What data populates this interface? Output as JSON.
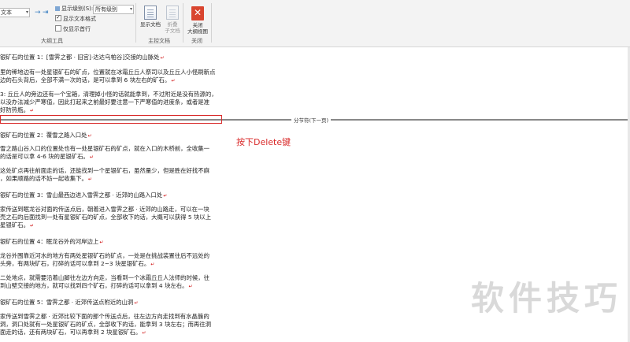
{
  "ribbon": {
    "outline_tools": {
      "text_combo": "文本",
      "show_level_label": "显示级别(S):",
      "show_level_value": "所有级别",
      "show_text_format": "显示文本格式",
      "show_first_line": "仅显示首行",
      "group_label": "大纲工具"
    },
    "master_doc": {
      "show_doc": "显示文档",
      "collapse_sub_l1": "折叠",
      "collapse_sub_l2": "子文档",
      "group_label": "主控文档"
    },
    "close": {
      "btn_l1": "关闭",
      "btn_l2": "大纲视图",
      "group_label": "关闭"
    }
  },
  "doc": {
    "lines": [
      "银矿石的位置 1：[雪霁之都 · 旧宫]·达达乌帕谷]交接的山脉处",
      "里的稀地边有一处星银矿石的矿点，位置就在冰霜丘丘人祭司以及丘丘人小怪刷新点",
      "边的石头背后，全部不满一次的话，是可以拿到 6 块左右的矿石。",
      "3: 丘丘人的旁边还有一个宝箱，清理掉小怪的话就能拿到，不过附近是没有热源的，",
      "以没办法减少严寒值，因此打起来之前最好要注意一下严寒值的进度条，或者是准",
      "好防热瓶。",
      "银矿石的位置 2：覆雪之路入口处",
      "雪之路山谷入口的位置处也有一处星银矿石的矿点，就在入口的木桥前，全收集一",
      "的话是可以拿 4-6 块的星银矿石。",
      "这处矿点再往前面走的话，还能找到一个星银矿石，虽然量少，但是胜在好找不麻",
      "，如果顺路的话不妨一起收集下。",
      "银矿石的位置 3：雪山最西边进入雪霁之都 · 近郊的山路入口处",
      "家传送到眠龙谷对面的传送点后，朝着进入雪霁之都 · 近郊的山路走，可以在一块",
      "壳之石的后面找到一处有星银矿石的矿点，全部收下的话，大概可以获得 5 块以上",
      "星银矿石。",
      "银矿石的位置 4：眠龙谷外的河岸边上",
      "龙谷外围靠近河水的地方有两处星银矿石的矿点，一处是在挑战装置往后不远处的",
      "头旁，有两块矿石，打碎的话可以拿到 2~3 块星银矿石。",
      "二处地点，就需要沿着山脚往左边方向走，当看到一个冰霜丘丘人法师的时候，往",
      "到山壁交接的地方，就可以找到四个矿石，打碎的话可以拿到 4 块左右。",
      "银矿石的位置 5：雪霁之都 · 近郊传送点附近的山洞",
      "家传送到雪霁之都 · 近郊比较下面的那个传送点后，往左边方向走找到有水晶簇的",
      "洞，洞口处就有一处星银矿石的矿点，全部收下的话，能拿到 3 块左右；而再往洞",
      "面走的话，还有两块矿石，可以再拿到 2 块星银矿石。"
    ],
    "section_break_label": "分节符(下一页)",
    "annotation": "按下Delete键"
  },
  "watermark": "软件技巧"
}
